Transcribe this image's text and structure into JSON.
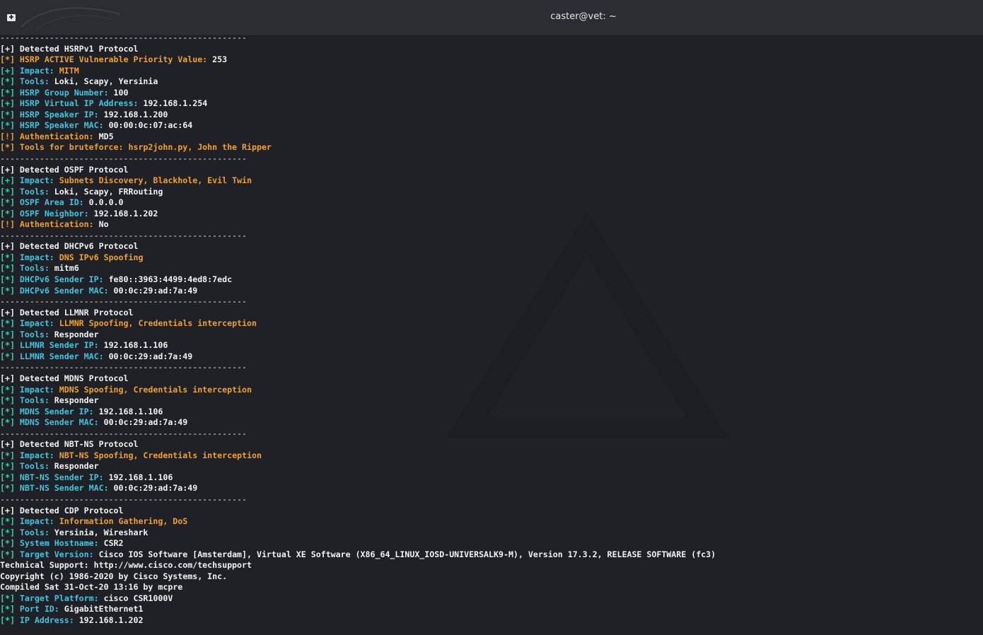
{
  "window": {
    "title": "caster@vet: ~"
  },
  "terminal": {
    "separator": "--------------------------------------------------",
    "lines": [
      {
        "type": "sep"
      },
      {
        "segs": [
          [
            "[+] Detected HSRPv1 Protocol",
            "c-white"
          ]
        ]
      },
      {
        "segs": [
          [
            "[*] HSRP ACTIVE Vulnerable Priority Value: ",
            "c-orange"
          ],
          [
            "253",
            "c-white"
          ]
        ]
      },
      {
        "segs": [
          [
            "[+] ",
            "c-green"
          ],
          [
            "Impact: ",
            "c-cyan"
          ],
          [
            "MITM",
            "c-orange"
          ]
        ]
      },
      {
        "segs": [
          [
            "[*] ",
            "c-green"
          ],
          [
            "Tools: ",
            "c-cyan"
          ],
          [
            "Loki, Scapy, Yersinia",
            "c-white"
          ]
        ]
      },
      {
        "segs": [
          [
            "[*] ",
            "c-green"
          ],
          [
            "HSRP Group Number: ",
            "c-cyan"
          ],
          [
            "100",
            "c-white"
          ]
        ]
      },
      {
        "segs": [
          [
            "[+] ",
            "c-green"
          ],
          [
            "HSRP Virtual IP Address: ",
            "c-cyan"
          ],
          [
            "192.168.1.254",
            "c-white"
          ]
        ]
      },
      {
        "segs": [
          [
            "[*] ",
            "c-green"
          ],
          [
            "HSRP Speaker IP: ",
            "c-cyan"
          ],
          [
            "192.168.1.200",
            "c-white"
          ]
        ]
      },
      {
        "segs": [
          [
            "[*] ",
            "c-green"
          ],
          [
            "HSRP Speaker MAC: ",
            "c-cyan"
          ],
          [
            "00:00:0c:07:ac:64",
            "c-white"
          ]
        ]
      },
      {
        "segs": [
          [
            "[!] Authentication: ",
            "c-orange"
          ],
          [
            "MD5",
            "c-white"
          ]
        ]
      },
      {
        "segs": [
          [
            "[*] Tools for bruteforce: hsrp2john.py, John the Ripper",
            "c-orange"
          ]
        ]
      },
      {
        "type": "sep"
      },
      {
        "segs": [
          [
            "[+] Detected OSPF Protocol",
            "c-white"
          ]
        ]
      },
      {
        "segs": [
          [
            "[+] ",
            "c-green"
          ],
          [
            "Impact: ",
            "c-cyan"
          ],
          [
            "Subnets Discovery, Blackhole, Evil Twin",
            "c-orange"
          ]
        ]
      },
      {
        "segs": [
          [
            "[*] ",
            "c-green"
          ],
          [
            "Tools: ",
            "c-cyan"
          ],
          [
            "Loki, Scapy, FRRouting",
            "c-white"
          ]
        ]
      },
      {
        "segs": [
          [
            "[*] ",
            "c-green"
          ],
          [
            "OSPF Area ID: ",
            "c-cyan"
          ],
          [
            "0.0.0.0",
            "c-white"
          ]
        ]
      },
      {
        "segs": [
          [
            "[*] ",
            "c-green"
          ],
          [
            "OSPF Neighbor: ",
            "c-cyan"
          ],
          [
            "192.168.1.202",
            "c-white"
          ]
        ]
      },
      {
        "segs": [
          [
            "[!] Authentication: ",
            "c-orange"
          ],
          [
            "No",
            "c-white"
          ]
        ]
      },
      {
        "type": "sep"
      },
      {
        "segs": [
          [
            "[+] Detected DHCPv6 Protocol",
            "c-white"
          ]
        ]
      },
      {
        "segs": [
          [
            "[*] ",
            "c-green"
          ],
          [
            "Impact: ",
            "c-cyan"
          ],
          [
            "DNS IPv6 Spoofing",
            "c-orange"
          ]
        ]
      },
      {
        "segs": [
          [
            "[*] ",
            "c-green"
          ],
          [
            "Tools: ",
            "c-cyan"
          ],
          [
            "mitm6",
            "c-white"
          ]
        ]
      },
      {
        "segs": [
          [
            "[*] ",
            "c-green"
          ],
          [
            "DHCPv6 Sender IP: ",
            "c-cyan"
          ],
          [
            "fe80::3963:4499:4ed8:7edc",
            "c-white"
          ]
        ]
      },
      {
        "segs": [
          [
            "[*] ",
            "c-green"
          ],
          [
            "DHCPv6 Sender MAC: ",
            "c-cyan"
          ],
          [
            "00:0c:29:ad:7a:49",
            "c-white"
          ]
        ]
      },
      {
        "type": "sep"
      },
      {
        "segs": [
          [
            "[+] Detected LLMNR Protocol",
            "c-white"
          ]
        ]
      },
      {
        "segs": [
          [
            "[*] ",
            "c-green"
          ],
          [
            "Impact: ",
            "c-cyan"
          ],
          [
            "LLMNR Spoofing, Credentials interception",
            "c-orange"
          ]
        ]
      },
      {
        "segs": [
          [
            "[*] ",
            "c-green"
          ],
          [
            "Tools: ",
            "c-cyan"
          ],
          [
            "Responder",
            "c-white"
          ]
        ]
      },
      {
        "segs": [
          [
            "[*] ",
            "c-green"
          ],
          [
            "LLMNR Sender IP: ",
            "c-cyan"
          ],
          [
            "192.168.1.106",
            "c-white"
          ]
        ]
      },
      {
        "segs": [
          [
            "[*] ",
            "c-green"
          ],
          [
            "LLMNR Sender MAC: ",
            "c-cyan"
          ],
          [
            "00:0c:29:ad:7a:49",
            "c-white"
          ]
        ]
      },
      {
        "type": "sep"
      },
      {
        "segs": [
          [
            "[+] Detected MDNS Protocol",
            "c-white"
          ]
        ]
      },
      {
        "segs": [
          [
            "[*] ",
            "c-green"
          ],
          [
            "Impact: ",
            "c-cyan"
          ],
          [
            "MDNS Spoofing, Credentials interception",
            "c-orange"
          ]
        ]
      },
      {
        "segs": [
          [
            "[*] ",
            "c-green"
          ],
          [
            "Tools: ",
            "c-cyan"
          ],
          [
            "Responder",
            "c-white"
          ]
        ]
      },
      {
        "segs": [
          [
            "[*] ",
            "c-green"
          ],
          [
            "MDNS Sender IP: ",
            "c-cyan"
          ],
          [
            "192.168.1.106",
            "c-white"
          ]
        ]
      },
      {
        "segs": [
          [
            "[*] ",
            "c-green"
          ],
          [
            "MDNS Sender MAC: ",
            "c-cyan"
          ],
          [
            "00:0c:29:ad:7a:49",
            "c-white"
          ]
        ]
      },
      {
        "type": "sep"
      },
      {
        "segs": [
          [
            "[+] Detected NBT-NS Protocol",
            "c-white"
          ]
        ]
      },
      {
        "segs": [
          [
            "[*] ",
            "c-green"
          ],
          [
            "Impact: ",
            "c-cyan"
          ],
          [
            "NBT-NS Spoofing, Credentials interception",
            "c-orange"
          ]
        ]
      },
      {
        "segs": [
          [
            "[*] ",
            "c-green"
          ],
          [
            "Tools: ",
            "c-cyan"
          ],
          [
            "Responder",
            "c-white"
          ]
        ]
      },
      {
        "segs": [
          [
            "[*] ",
            "c-green"
          ],
          [
            "NBT-NS Sender IP: ",
            "c-cyan"
          ],
          [
            "192.168.1.106",
            "c-white"
          ]
        ]
      },
      {
        "segs": [
          [
            "[*] ",
            "c-green"
          ],
          [
            "NBT-NS Sender MAC: ",
            "c-cyan"
          ],
          [
            "00:0c:29:ad:7a:49",
            "c-white"
          ]
        ]
      },
      {
        "type": "sep"
      },
      {
        "segs": [
          [
            "[+] Detected CDP Protocol",
            "c-white"
          ]
        ]
      },
      {
        "segs": [
          [
            "[*] ",
            "c-green"
          ],
          [
            "Impact: ",
            "c-cyan"
          ],
          [
            "Information Gathering, DoS",
            "c-orange"
          ]
        ]
      },
      {
        "segs": [
          [
            "[*] ",
            "c-green"
          ],
          [
            "Tools: ",
            "c-cyan"
          ],
          [
            "Yersinia, Wireshark",
            "c-white"
          ]
        ]
      },
      {
        "segs": [
          [
            "[*] ",
            "c-green"
          ],
          [
            "System Hostname: ",
            "c-cyan"
          ],
          [
            "CSR2",
            "c-white"
          ]
        ]
      },
      {
        "segs": [
          [
            "[*] ",
            "c-green"
          ],
          [
            "Target Version: ",
            "c-cyan"
          ],
          [
            "Cisco IOS Software [Amsterdam], Virtual XE Software (X86_64_LINUX_IOSD-UNIVERSALK9-M), Version 17.3.2, RELEASE SOFTWARE (fc3)",
            "c-white"
          ]
        ]
      },
      {
        "segs": [
          [
            "Technical Support: http://www.cisco.com/techsupport",
            "c-white"
          ]
        ]
      },
      {
        "segs": [
          [
            "Copyright (c) 1986-2020 by Cisco Systems, Inc.",
            "c-white"
          ]
        ]
      },
      {
        "segs": [
          [
            "Compiled Sat 31-Oct-20 13:16 by mcpre",
            "c-white"
          ]
        ]
      },
      {
        "segs": [
          [
            "[*] ",
            "c-green"
          ],
          [
            "Target Platform: ",
            "c-cyan"
          ],
          [
            "cisco CSR1000V",
            "c-white"
          ]
        ]
      },
      {
        "segs": [
          [
            "[*] ",
            "c-green"
          ],
          [
            "Port ID: ",
            "c-cyan"
          ],
          [
            "GigabitEthernet1",
            "c-white"
          ]
        ]
      },
      {
        "segs": [
          [
            "[*] ",
            "c-green"
          ],
          [
            "IP Address: ",
            "c-cyan"
          ],
          [
            "192.168.1.202",
            "c-white"
          ]
        ]
      }
    ]
  },
  "icons": {
    "new_tab": "terminal-tab-icon",
    "background": "kali-dragon-logo-icon"
  },
  "colors": {
    "background": "#1f2126",
    "titlebar": "#2b2d33",
    "orange": "#f0a02c",
    "green": "#33d0b0",
    "cyan": "#40c4e0",
    "white": "#f2f2f2"
  }
}
